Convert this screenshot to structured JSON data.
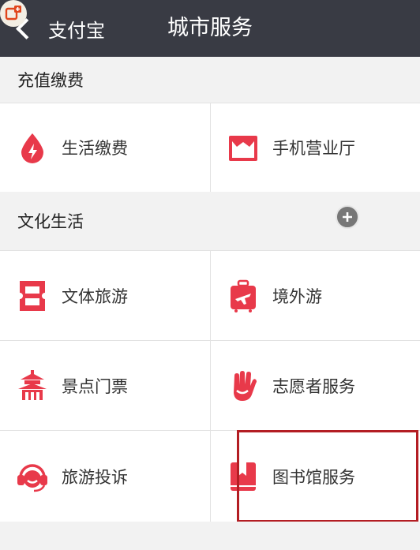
{
  "navbar": {
    "back_label": "支付宝",
    "title": "城市服务"
  },
  "sections": [
    {
      "header": "充值缴费"
    },
    {
      "header": "文化生活"
    }
  ],
  "services": {
    "utilities": "生活缴费",
    "mobile_hall": "手机营业厅",
    "culture_sports": "文体旅游",
    "overseas": "境外游",
    "scenic_tickets": "景点门票",
    "volunteer": "志愿者服务",
    "complaint": "旅游投诉",
    "library": "图书馆服务"
  },
  "highlighted_service": "图书馆服务",
  "partial_next_section": "",
  "colors": {
    "navbar": "#393b44",
    "accent": "#e8394a",
    "highlight": "#b31d23"
  },
  "icons": {
    "utilities": "drop-icon",
    "mobile_hall": "shop-icon",
    "culture_sports": "ticket-icon",
    "overseas": "suitcase-plane-icon",
    "scenic_tickets": "pagoda-icon",
    "volunteer": "hand-icon",
    "complaint": "headset-icon",
    "library": "book-icon"
  }
}
